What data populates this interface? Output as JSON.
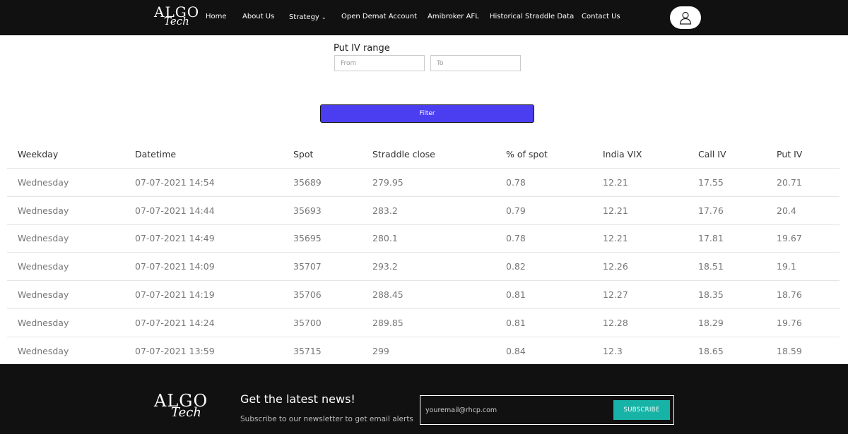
{
  "nav": {
    "logo_top": "ALGO",
    "logo_bottom": "Tech",
    "items": [
      {
        "label": "Home"
      },
      {
        "label": "About Us"
      },
      {
        "label": "Strategy"
      },
      {
        "label": "Open Demat Account"
      },
      {
        "label": "Amibroker AFL"
      },
      {
        "label": "Historical Straddle Data"
      },
      {
        "label": "Contact Us"
      }
    ]
  },
  "filter": {
    "title": "Put IV range",
    "from_placeholder": "From",
    "to_placeholder": "To",
    "button_label": "Filter"
  },
  "table": {
    "headers": [
      "Weekday",
      "Datetime",
      "Spot",
      "Straddle close",
      "% of spot",
      "India VIX",
      "Call IV",
      "Put IV"
    ],
    "rows": [
      [
        "Wednesday",
        "07-07-2021 14:54",
        "35689",
        "279.95",
        "0.78",
        "12.21",
        "17.55",
        "20.71"
      ],
      [
        "Wednesday",
        "07-07-2021 14:44",
        "35693",
        "283.2",
        "0.79",
        "12.21",
        "17.76",
        "20.4"
      ],
      [
        "Wednesday",
        "07-07-2021 14:49",
        "35695",
        "280.1",
        "0.78",
        "12.21",
        "17.81",
        "19.67"
      ],
      [
        "Wednesday",
        "07-07-2021 14:09",
        "35707",
        "293.2",
        "0.82",
        "12.26",
        "18.51",
        "19.1"
      ],
      [
        "Wednesday",
        "07-07-2021 14:19",
        "35706",
        "288.45",
        "0.81",
        "12.27",
        "18.35",
        "18.76"
      ],
      [
        "Wednesday",
        "07-07-2021 14:24",
        "35700",
        "289.85",
        "0.81",
        "12.28",
        "18.29",
        "19.76"
      ],
      [
        "Wednesday",
        "07-07-2021 13:59",
        "35715",
        "299",
        "0.84",
        "12.3",
        "18.65",
        "18.59"
      ]
    ]
  },
  "footer": {
    "logo_top": "ALGO",
    "logo_bottom": "Tech",
    "news_title": "Get the latest news!",
    "news_subtitle": "Subscribe to our newsletter to get email alerts",
    "email_placeholder": "youremail@rhcp.com",
    "subscribe_label": "SUBSCRIBE"
  },
  "colors": {
    "nav_bg": "#111111",
    "filter_button": "#4a3ef0",
    "subscribe_button": "#17b3a6"
  }
}
